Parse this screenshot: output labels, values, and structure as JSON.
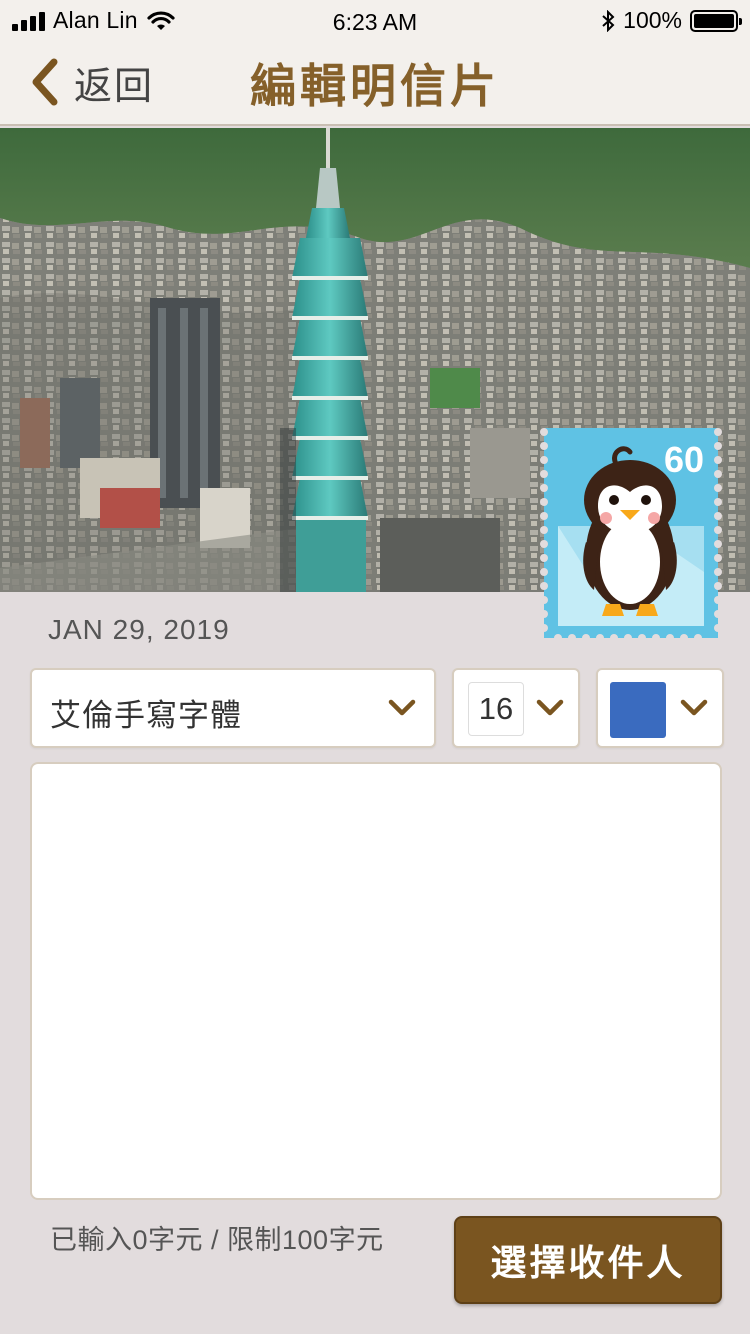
{
  "status_bar": {
    "carrier": "Alan Lin",
    "time": "6:23 AM",
    "battery": "100%",
    "battery_level": 1.0
  },
  "nav": {
    "back_label": "返回",
    "title": "編輯明信片"
  },
  "stamp": {
    "value": "60"
  },
  "postcard": {
    "date": "JAN 29, 2019"
  },
  "controls": {
    "font_value": "艾倫手寫字體",
    "size_value": "16",
    "color_value": "#3a6bbf"
  },
  "message": {
    "value": ""
  },
  "footer": {
    "counter": "已輸入0字元 / 限制100字元",
    "submit_label": "選擇收件人"
  },
  "colors": {
    "accent": "#85602a",
    "button": "#7a5520",
    "background": "#e2dcdd"
  }
}
